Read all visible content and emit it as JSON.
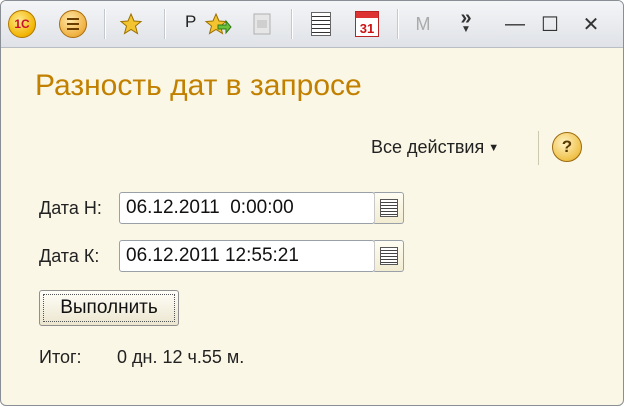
{
  "toolbar": {
    "logo_text": "1С",
    "r_label": "Р",
    "calendar_day": "31",
    "m_label": "М",
    "more_label": "»"
  },
  "window_controls": {
    "close_label": "✕",
    "maximize_label": "☐",
    "minimize_label": "—"
  },
  "form": {
    "title": "Разность дат в запросе",
    "all_actions_label": "Все действия",
    "help_label": "?",
    "date_start_label": "Дата Н:",
    "date_start_value": "06.12.2011  0:00:00",
    "date_end_label": "Дата К:",
    "date_end_value": "06.12.2011 12:55:21",
    "run_button_label": "Выполнить",
    "result_label": "Итог:",
    "result_value": "0 дн. 12 ч.55 м."
  },
  "colors": {
    "title": "#c18000",
    "window_bg": "#fbf7e6"
  }
}
